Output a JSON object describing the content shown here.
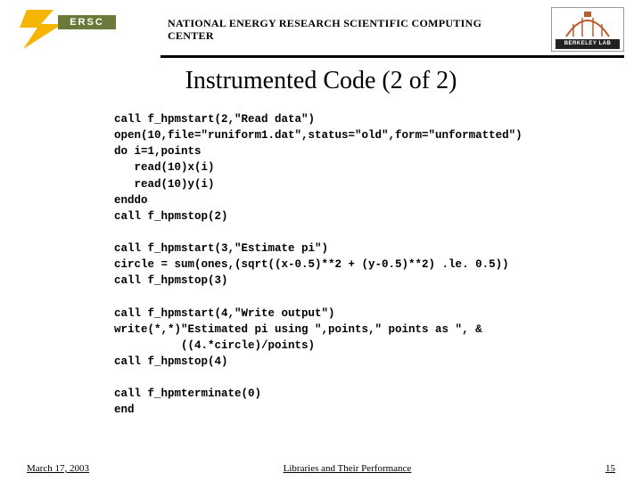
{
  "header": {
    "nersc_label": "ERSC",
    "org_line1": "NATIONAL ENERGY RESEARCH SCIENTIFIC COMPUTING",
    "org_line2": "CENTER",
    "lab_label": "BERKELEY LAB"
  },
  "title": "Instrumented Code (2 of 2)",
  "code_block": "call f_hpmstart(2,\"Read data\")\nopen(10,file=\"runiform1.dat\",status=\"old\",form=\"unformatted\")\ndo i=1,points\n   read(10)x(i)\n   read(10)y(i)\nenddo\ncall f_hpmstop(2)\n\ncall f_hpmstart(3,\"Estimate pi\")\ncircle = sum(ones,(sqrt((x-0.5)**2 + (y-0.5)**2) .le. 0.5))\ncall f_hpmstop(3)\n\ncall f_hpmstart(4,\"Write output\")\nwrite(*,*)\"Estimated pi using \",points,\" points as \", &\n          ((4.*circle)/points)\ncall f_hpmstop(4)\n\ncall f_hpmterminate(0)\nend",
  "footer": {
    "date": "March 17, 2003",
    "center": "Libraries and Their Performance",
    "page": "15"
  }
}
